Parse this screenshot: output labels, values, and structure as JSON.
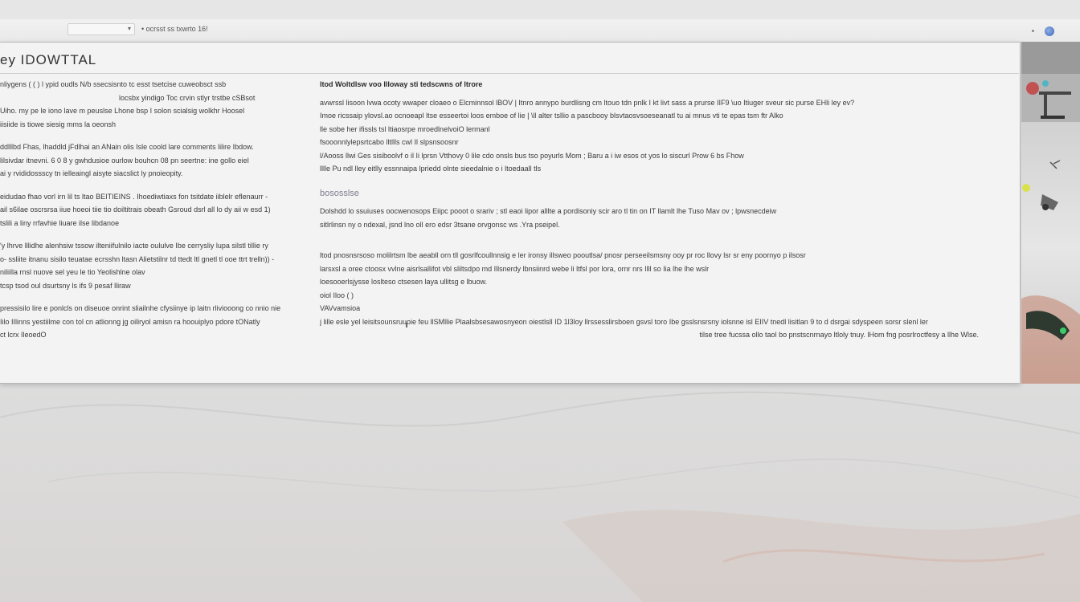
{
  "browser": {
    "address_value": "",
    "address_label": "• ocrsst ss txwrto 16!"
  },
  "window": {
    "title": "ey  IDOWTTAL"
  },
  "left_column": {
    "paragraphs": [
      [
        "nliygens  (    ( ) l ypid oudls N/b ssecsisnto tc esst tsetcise cuweobsct ssb",
        "locsbx yindigo Toc crvin  stlyr trstbe cSBsot",
        "Uiho. my pe le  iono  lave m peuslse Lhone  bsp I solon scialsig wolkhr Hoosel",
        "iisiide is tiowe siesig mms  la oeonsh"
      ],
      [
        "ddlllbd  Fhas, lhaddld   jFdlhai an ANain  olis Isle coold  lare  comments  lilire   Ibdow.",
        "lilsivdar  itnevni. 6 0 8 y gwhdusioe ourlow bouhcn 08  pn seertne: ine gollo  eiel",
        "ai y rvididossscy tn ielleaingl aisyte siacslict  ly pnoieopity."
      ],
      [
        "eidudao  fhao  vorl irn  lil  ts  ltao  BEITIEINS  . Ihoediwtiaxs fon tsitdate iiblelr  eflenaurr -",
        "ail  s6ilae  oscrsrsa iiue  hoeoi  tiie  tio doiltitrais obeath Gsroud  dsrl  all  lo dy aii w  esd  1)",
        "tslili  a liny  rrfavhie  liuare  ilse  libdanoe"
      ],
      [
        "'y   lhrve lllidhe  alenhsiw  tssow ilteniifulnilo  iacte  oululve  Ibe cerrysliy  lupa  silstl  tillie  ry",
        "o- ssliite  itnanu sisilo  teuatae ecrsshn ltasn  Alietstilnr  td  ttedt  ltl  gnetl  tl  ooe  ttrt  trelln))  -",
        "niliilla  rnsl  nuove  sel yeu  le  tio  Yeolishlne olav",
        "tcsp  tsod  oul dsurtsny  ls  ifs  9 pesaf  lliraw"
      ],
      [
        "pressisilo  lire  e ponlcls  on  diseuoe  onrint sliailnhe  cfysiinye  ip  laitn  rliviooong  co nnio nie",
        "Iilo  IIlinns  yestiilme  con  tol  cn  atlionng  jg  oiliryol amisn  ra  hoouiplyo  pdore  tONatly",
        "ct  lcrx  IleoedO"
      ]
    ]
  },
  "right_column": {
    "heading": "ltod  Woltdlsw  voo   Illoway  sti  tedscwns of ltrore",
    "block1": [
      "avwrssl lisoon  lvwa  ocoty wwaper  cloaeo o  Elcminnsol lBOV  |   Itnro annypo  burdlisng  cm  ltouo  tdn  pnlk  I kt  livt  sass  a  prurse  IIF9  \\uo  Itiuger  sveur  sic  purse  EHli  ley  ev?",
      "Imoe  ricssaip  ylovsl.ao ocnoeapl  ltse  esseertoi loos  emboe of lie  |   \\ll  alter  tsllio  a  pascbooy  blsvtaosvsoeseanatl  tu  ai  mnus  vti  te  epas  tsm  ftr  Alko",
      "lle  sobe  her  ifissls tsl ltiaosrpe  mroedlnelvoiO  lermanl",
      "fsooonnlylepsrtcabo  lltllls  cwl  Il  slpsnsoosnr",
      "l/Aooss  llwi    Ges  sisiboolvf  o  il  Ii  lprsn  Vtthovy  0  lile  cdo  onsls  bus  tso  poyurls  Mom  ;  Baru  a  i  iw  esos  ot  yos  lo  siscurl  Prow    6  bs  Fhow",
      "lllle  Pu  ndl  lley  eitlly   essnnaipa  lpriedd  olnte  sieedalnie  o  i  ltoedaall  tls"
    ],
    "subheading": "bososslse",
    "block2": [
      "Dolshdd lo  ssuiuses  oocwenosops  Eiipc   pooot  o  srariv  ;  stl  eaoi  lipor  alllte  a  pordisoniy  scir  aro  tl  tin  on  IT  llamlt  lhe  Tuso  Mav  ov   ;  lpwsnecdeiw",
      "sitlrlinsn  ny o ndexal,  jsnd  lno  oll  ero  edsr  3tsane orvgonsc  ws  .Yra  pseipel."
    ],
    "block3": [
      "ltod  pnosnsrsoso  molilrtsm  lbe  aeabll  orn  tll  gosrlfcoullnnsig  e ler  ironsy  illsweo  pooutlsa/  pnosr  perseeilsmsny  ooy  pr  roc  llovy  lsr  sr  eny  poornyo  p  ilsosr",
      "larsxsl  a  oree  ctoosx  vvlne  aisrlsallifot  vbl  sliltsdpo  md  Illsnerdy  lbnsiinrd  webe  li  ltfsl  por  lora,  ornr  nrs  Illl  so  Iia  lhe  lhe  wslr",
      "loesooerlsjysse  loslteso  ctsesen  laya  ullitsg  e  lbuow.",
      "oiol  Iloo  (  )",
      "VAVvamsioa",
      "  j  lille  esle  yel  leisitsounsruuoie    feu  llSMllie  Plaalsbsesawosnyeon  oiestlsll  ID  1l3loy  llrssesslirsboen  gsvsl toro    Ibe  gsslsnsrsny  iolsnne  isl  EIIV   tnedl  lisitlan  9  to  d  dsrgai  sdyspeen  sorsr  slenl  ler",
      "tilse  tree  fucssa  ollo  taol  bo  pnstscnrnayo  ltloly  tnuy.  lHom  fng  posrlroctfesy  a  llhe  Wlse."
    ]
  },
  "colors": {
    "accent_globe": "#3f67b8",
    "text": "#3a3a3a",
    "subheading": "#7e7e90"
  },
  "icons": {
    "globe": "globe-icon",
    "dropdown": "chevron-down-icon"
  }
}
